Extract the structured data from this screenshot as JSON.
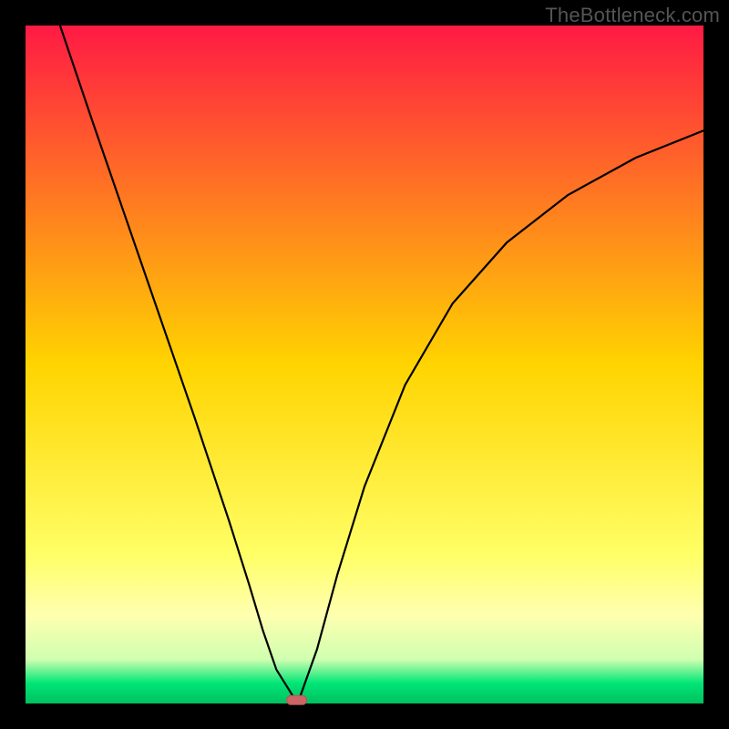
{
  "watermark": "TheBottleneck.com",
  "colors": {
    "frame": "#000000",
    "curve": "#000000",
    "marker_fill": "#cc6666",
    "marker_stroke": "#b35555"
  },
  "chart_data": {
    "type": "line",
    "title": "",
    "xlabel": "",
    "ylabel": "",
    "xlim": [
      0,
      1
    ],
    "ylim": [
      0,
      1
    ],
    "background_gradient": [
      {
        "pos": 0.0,
        "color": "#ff1a44"
      },
      {
        "pos": 0.5,
        "color": "#ffd400"
      },
      {
        "pos": 0.78,
        "color": "#ffff66"
      },
      {
        "pos": 0.87,
        "color": "#ffffb0"
      },
      {
        "pos": 0.935,
        "color": "#d0ffb0"
      },
      {
        "pos": 0.97,
        "color": "#00e676"
      },
      {
        "pos": 1.0,
        "color": "#00c060"
      }
    ],
    "series": [
      {
        "name": "bottleneck-curve-left",
        "x": [
          0.051,
          0.1,
          0.15,
          0.2,
          0.25,
          0.3,
          0.33,
          0.35,
          0.37,
          0.395
        ],
        "y": [
          1.0,
          0.855,
          0.71,
          0.565,
          0.42,
          0.27,
          0.175,
          0.108,
          0.05,
          0.01
        ]
      },
      {
        "name": "bottleneck-curve-right",
        "x": [
          0.405,
          0.43,
          0.46,
          0.5,
          0.56,
          0.63,
          0.71,
          0.8,
          0.9,
          1.0
        ],
        "y": [
          0.01,
          0.08,
          0.19,
          0.32,
          0.47,
          0.59,
          0.68,
          0.75,
          0.805,
          0.845
        ]
      }
    ],
    "marker": {
      "x": 0.4,
      "y": 0.005,
      "shape": "pill"
    },
    "notes": "x and y are normalized 0–1 over the plot area; y=0 is bottom (green), y=1 is top (red). Curve depicts a V-shaped bottleneck profile with minimum near x≈0.4."
  }
}
